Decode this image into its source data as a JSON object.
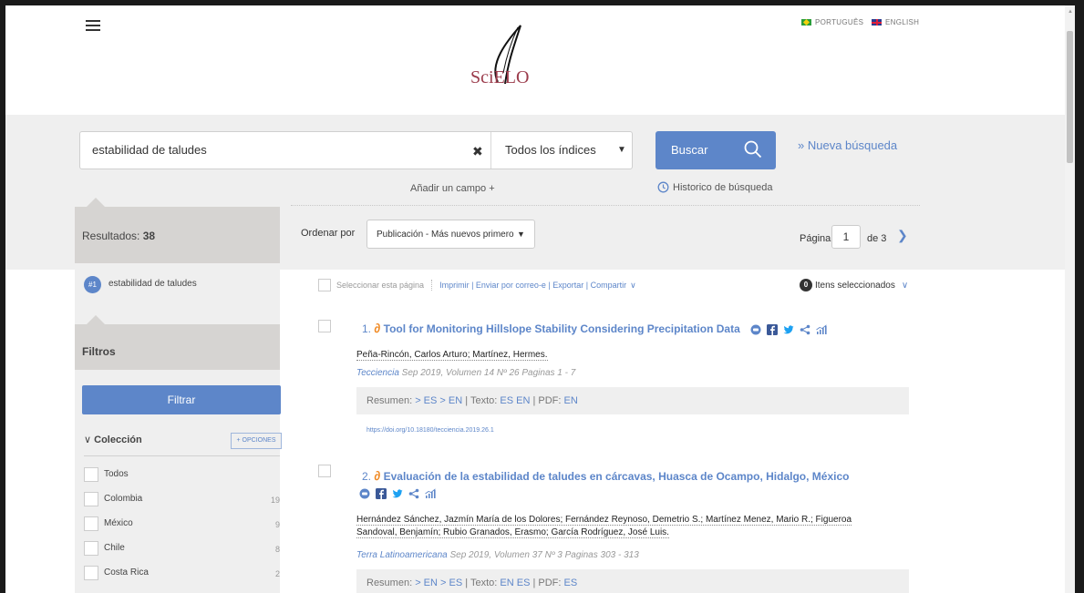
{
  "header": {
    "logo_text": "SciELO",
    "lang_pt": "PORTUGUÊS",
    "lang_en": "ENGLISH"
  },
  "search": {
    "query": "estabilidad de taludes",
    "index_select": "Todos los índices",
    "button": "Buscar",
    "new_search": "» Nueva búsqueda",
    "add_field": "Añadir un campo +",
    "history": "Historico de búsqueda"
  },
  "results_bar": {
    "results_label": "Resultados:",
    "results_count": "38",
    "order_label": "Ordenar por",
    "order_value": "Publicación - Más nuevos primero",
    "page_label": "Página",
    "page_value": "1",
    "page_of": "de 3"
  },
  "sidebar": {
    "query_num": "#1",
    "query_text": "estabilidad de taludes",
    "filters_title": "Filtros",
    "filter_button": "Filtrar",
    "collection_title": "Colección",
    "options_button": "+ OPCIONES",
    "items": [
      {
        "label": "Todos",
        "count": ""
      },
      {
        "label": "Colombia",
        "count": "19"
      },
      {
        "label": "México",
        "count": "9"
      },
      {
        "label": "Chile",
        "count": "8"
      },
      {
        "label": "Costa Rica",
        "count": "2"
      }
    ]
  },
  "selection": {
    "select_page": "Seleccionar esta página",
    "actions": "Imprimir | Enviar por correo-e | Exportar | Compartir",
    "selected_count": "0",
    "selected_label": "Itens seleccionados"
  },
  "results": [
    {
      "num": "1.",
      "title": "Tool for Monitoring Hillslope Stability Considering Precipitation Data",
      "authors_line1": "Peña-Rincón, Carlos Arturo; Martínez, Hermes.",
      "authors_line2": "",
      "journal": "Tecciencia",
      "meta": " Sep 2019, Volumen 14   Nº 26   Paginas 1 - 7",
      "resumen_label": "Resumen:",
      "resumen_links": "> ES  > EN",
      "texto_label": "Texto:",
      "texto_links": "ES  EN",
      "pdf_label": "PDF:",
      "pdf_links": "EN",
      "doi": "https://doi.org/10.18180/tecciencia.2019.26.1"
    },
    {
      "num": "2.",
      "title": "Evaluación de la estabilidad de taludes en cárcavas, Huasca de Ocampo, Hidalgo, México",
      "authors_line1": "Hernández Sánchez, Jazmín María de los Dolores; Fernández Reynoso, Demetrio S.; Martínez Menez, Mario R.; Figueroa",
      "authors_line2": "Sandoval, Benjamín; Rubio Granados, Erasmo; García Rodríguez, José Luis.",
      "journal": "Terra Latinoamericana",
      "meta": " Sep 2019, Volumen 37   Nº 3   Paginas 303 - 313",
      "resumen_label": "Resumen:",
      "resumen_links": "> EN  > ES",
      "texto_label": "Texto:",
      "texto_links": "EN  ES",
      "pdf_label": "PDF:",
      "pdf_links": "ES",
      "doi": ""
    }
  ],
  "colors": {
    "accent": "#5d86c9",
    "band": "#efefef",
    "header_gray": "#d6d4d2",
    "open_access": "#f08a24"
  }
}
